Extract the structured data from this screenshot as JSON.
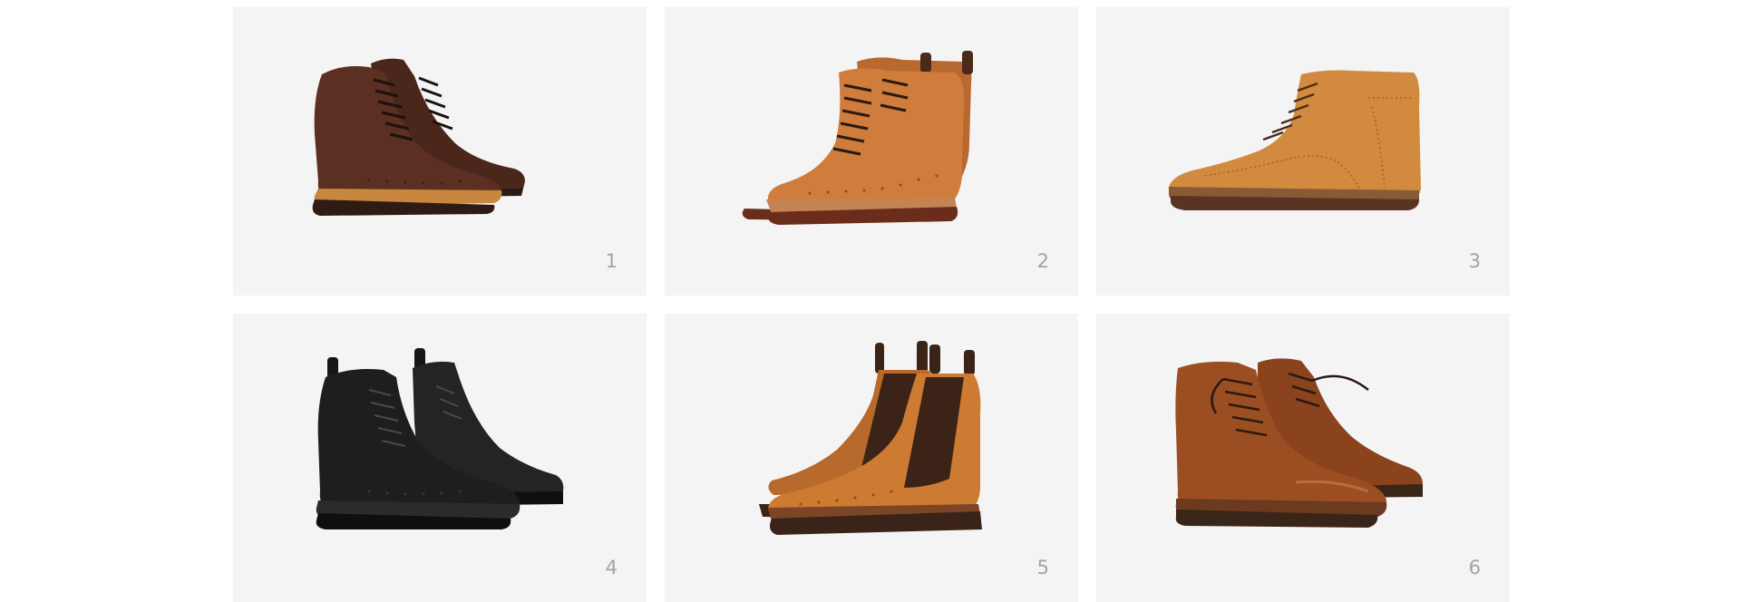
{
  "gallery": {
    "items": [
      {
        "number": "1",
        "color": "#5a2f22",
        "sole": "#2e1c14",
        "welt": "#c9873f",
        "style": "wingtip lace-up boot pair"
      },
      {
        "number": "2",
        "color": "#c9763a",
        "sole": "#6a2d1c",
        "welt": "#c48353",
        "style": "wingtip lace-up boot pair"
      },
      {
        "number": "3",
        "color": "#d18a3e",
        "sole": "#5a3422",
        "welt": "#8a5a36",
        "style": "single wingtip lace-up boot"
      },
      {
        "number": "4",
        "color": "#1e1e1e",
        "sole": "#0f0f0f",
        "welt": "#2b2b2b",
        "style": "black wingtip lace-up boot pair"
      },
      {
        "number": "5",
        "color": "#cd7a33",
        "sole": "#3a2318",
        "welt": "#7b4526",
        "style": "brogue chelsea boot pair",
        "elastic": "#3b2417"
      },
      {
        "number": "6",
        "color": "#9b4e22",
        "sole": "#3a2619",
        "welt": "#6b3a1f",
        "style": "wingtip lace-up boot pair"
      }
    ]
  }
}
